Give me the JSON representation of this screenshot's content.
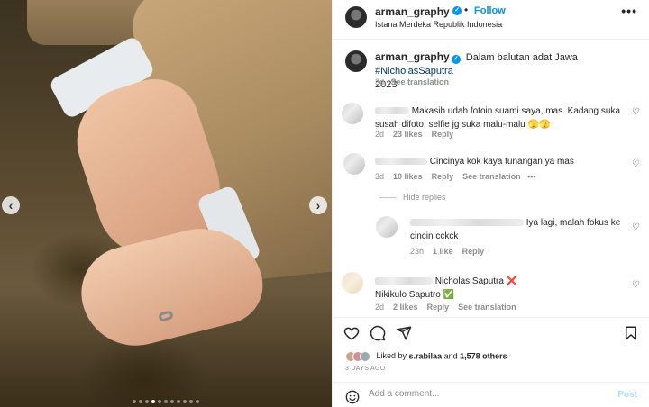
{
  "photo": {
    "carousel_dots": 11,
    "active_dot_index": 3
  },
  "header": {
    "username": "arman_graphy",
    "verified_mark": "✓",
    "separator": "•",
    "follow_label": "Follow",
    "location": "Istana Merdeka Republik Indonesia",
    "more_icon": "•••"
  },
  "caption": {
    "username": "arman_graphy",
    "text": "Dalam balutan adat Jawa ",
    "hashtag": "#NicholasSaputra",
    "text_after": "2023",
    "time": "3d",
    "see_translation": "See translation"
  },
  "comments": [
    {
      "text": "Makasih udah fotoin suami saya, mas. Kadang suka susah difoto, selfie jg suka malu-malu 🫣🫣",
      "time": "2d",
      "likes": "23 likes",
      "reply": "Reply"
    },
    {
      "text": "Cincinya kok kaya tunangan ya mas",
      "time": "3d",
      "likes": "10 likes",
      "reply": "Reply",
      "see_translation": "See translation",
      "more": "•••"
    },
    {
      "text": "Iya lagi, malah fokus ke cincin cckck",
      "time": "23h",
      "likes": "1 like",
      "reply": "Reply"
    },
    {
      "name_suffix": "Nicholas Saputra ❌",
      "text": "Nikikulo Saputro ✅",
      "time": "2d",
      "likes": "2 likes",
      "reply": "Reply",
      "see_translation": "See translation"
    }
  ],
  "hide_replies": "Hide replies",
  "likes": {
    "liked_by_prefix": "Liked by ",
    "liked_by_user": "s.rabilaa",
    "and": " and ",
    "others": "1,578 others"
  },
  "date": "3 DAYS AGO",
  "add_comment": {
    "placeholder": "Add a comment...",
    "post_label": "Post"
  },
  "colors": {
    "accent_blue": "#0095f6",
    "muted": "#8e8e8e",
    "text": "#262626"
  }
}
